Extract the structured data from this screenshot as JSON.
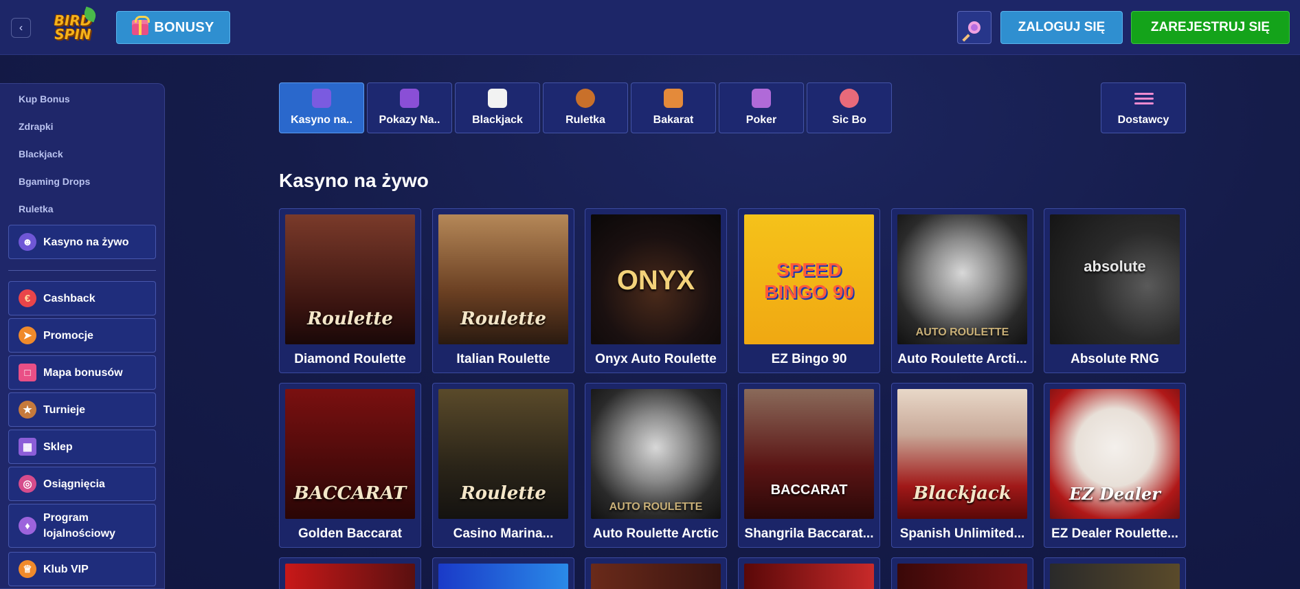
{
  "header": {
    "back_icon": "chevron-left-icon",
    "logo_top": "BIRD",
    "logo_bottom": "SPIN",
    "bonus_label": "BONUSY",
    "login_label": "ZALOGUJ SIĘ",
    "register_label": "ZAREJESTRUJ SIĘ",
    "colors": {
      "header_bg": "#1d2668",
      "login": "#2f8fd0",
      "register": "#14a31a"
    }
  },
  "sidebar": {
    "links": [
      "Kup Bonus",
      "Zdrapki",
      "Blackjack",
      "Bgaming Drops",
      "Ruletka"
    ],
    "active_item": {
      "label": "Kasyno na żywo",
      "icon": "live-dealer-icon"
    },
    "items": [
      {
        "label": "Cashback",
        "icon": "euro-icon"
      },
      {
        "label": "Promocje",
        "icon": "megaphone-icon"
      },
      {
        "label": "Mapa bonusów",
        "icon": "gift-icon"
      },
      {
        "label": "Turnieje",
        "icon": "trophy-icon"
      },
      {
        "label": "Sklep",
        "icon": "shop-icon"
      },
      {
        "label": "Osiągnięcia",
        "icon": "target-icon"
      },
      {
        "label": "Program lojalnościowy",
        "icon": "loyalty-icon"
      },
      {
        "label": "Klub VIP",
        "icon": "crown-icon"
      }
    ]
  },
  "tabs": [
    {
      "label": "Kasyno na..",
      "icon": "live-dealer-icon",
      "active": true
    },
    {
      "label": "Pokazy Na..",
      "icon": "tv-show-icon",
      "active": false
    },
    {
      "label": "Blackjack",
      "icon": "cards-icon",
      "active": false
    },
    {
      "label": "Ruletka",
      "icon": "roulette-icon",
      "active": false
    },
    {
      "label": "Bakarat",
      "icon": "baccarat-icon",
      "active": false
    },
    {
      "label": "Poker",
      "icon": "poker-icon",
      "active": false
    },
    {
      "label": "Sic Bo",
      "icon": "dice-icon",
      "active": false
    }
  ],
  "providers_label": "Dostawcy",
  "section_title": "Kasyno na żywo",
  "games": [
    {
      "name": "Diamond Roulette",
      "art": "Roulette"
    },
    {
      "name": "Italian Roulette",
      "art": "Roulette"
    },
    {
      "name": "Onyx Auto Roulette",
      "art": "ONYX"
    },
    {
      "name": "EZ Bingo 90",
      "art": "SPEED BINGO 90"
    },
    {
      "name": "Auto Roulette Arcti...",
      "art": "AUTO ROULETTE"
    },
    {
      "name": "Absolute RNG",
      "art": "absolute"
    },
    {
      "name": "Golden Baccarat",
      "art": "BACCARAT"
    },
    {
      "name": "Casino Marina...",
      "art": "Roulette"
    },
    {
      "name": "Auto Roulette Arctic",
      "art": "AUTO ROULETTE"
    },
    {
      "name": "Shangrila Baccarat...",
      "art": "BACCARAT"
    },
    {
      "name": "Spanish Unlimited...",
      "art": "Blackjack"
    },
    {
      "name": "EZ Dealer Roulette...",
      "art": "EZ Dealer"
    }
  ]
}
